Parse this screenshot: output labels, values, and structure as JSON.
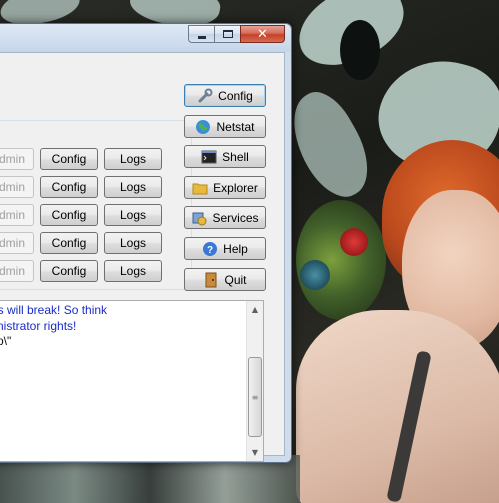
{
  "window": {
    "caption_buttons": {
      "minimize_icon": "minimize-icon",
      "maximize_icon": "maximize-icon",
      "close_icon": "close-icon"
    }
  },
  "service_rows": [
    {
      "admin_label": "Admin",
      "config_label": "Config",
      "logs_label": "Logs"
    },
    {
      "admin_label": "Admin",
      "config_label": "Config",
      "logs_label": "Logs"
    },
    {
      "admin_label": "Admin",
      "config_label": "Config",
      "logs_label": "Logs"
    },
    {
      "admin_label": "Admin",
      "config_label": "Config",
      "logs_label": "Logs"
    },
    {
      "admin_label": "Admin",
      "config_label": "Config",
      "logs_label": "Logs"
    }
  ],
  "side_buttons": [
    {
      "label": "Config",
      "icon": "wrench-icon"
    },
    {
      "label": "Netstat",
      "icon": "globe-icon"
    },
    {
      "label": "Shell",
      "icon": "terminal-icon"
    },
    {
      "label": "Explorer",
      "icon": "folder-icon"
    },
    {
      "label": "Services",
      "icon": "services-icon"
    },
    {
      "label": "Help",
      "icon": "help-icon"
    },
    {
      "label": "Quit",
      "icon": "door-icon"
    }
  ],
  "log": {
    "lines": [
      "gs will break! So think",
      "nistrator rights!",
      "p\\\""
    ]
  },
  "colors": {
    "log_warning": "#1a2bc8",
    "titlebar": "#c5d6ea",
    "close_button": "#c4412a"
  }
}
